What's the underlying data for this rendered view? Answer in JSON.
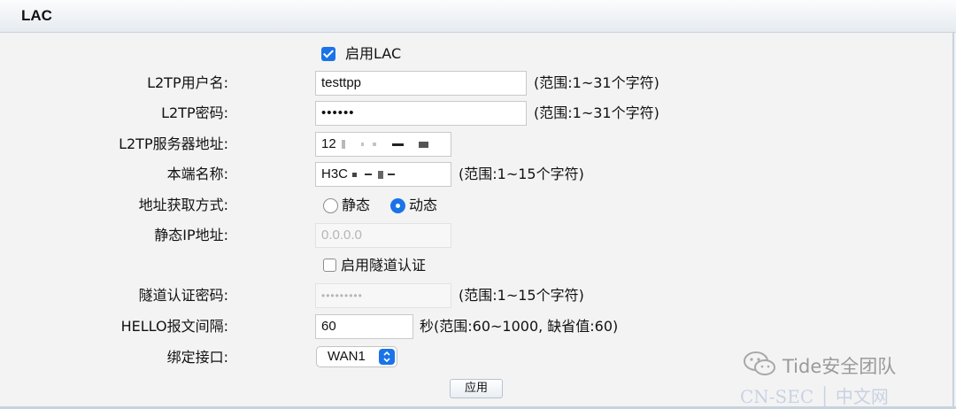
{
  "section": {
    "title": "LAC"
  },
  "enable_lac": {
    "label": "启用LAC",
    "checked": true
  },
  "username": {
    "label": "L2TP用户名:",
    "value": "testtpp",
    "hint": "(范围:1~31个字符)"
  },
  "password": {
    "label": "L2TP密码:",
    "value": "••••••",
    "hint": "(范围:1~31个字符)"
  },
  "server": {
    "label": "L2TP服务器地址:",
    "value": "12"
  },
  "local_name": {
    "label": "本端名称:",
    "value": "H3C",
    "hint": "(范围:1~15个字符)"
  },
  "addr_mode": {
    "label": "地址获取方式:",
    "static": "静态",
    "dynamic": "动态",
    "selected": "dynamic"
  },
  "static_ip": {
    "label": "静态IP地址:",
    "placeholder": "0.0.0.0"
  },
  "tunnel_auth": {
    "label": "启用隧道认证",
    "checked": false
  },
  "tunnel_pwd": {
    "label": "隧道认证密码:",
    "value": "•••••••••",
    "hint": "(范围:1~15个字符)"
  },
  "hello": {
    "label": "HELLO报文间隔:",
    "value": "60",
    "hint": "秒(范围:60~1000, 缺省值:60)"
  },
  "bind_iface": {
    "label": "绑定接口:",
    "selected": "WAN1"
  },
  "apply_label": "应用",
  "watermark": {
    "text": "Tide安全团队",
    "site": "CN-SEC │ 中文网"
  },
  "colors": {
    "accent": "#1a73e8",
    "header": "#e6ebf0"
  }
}
